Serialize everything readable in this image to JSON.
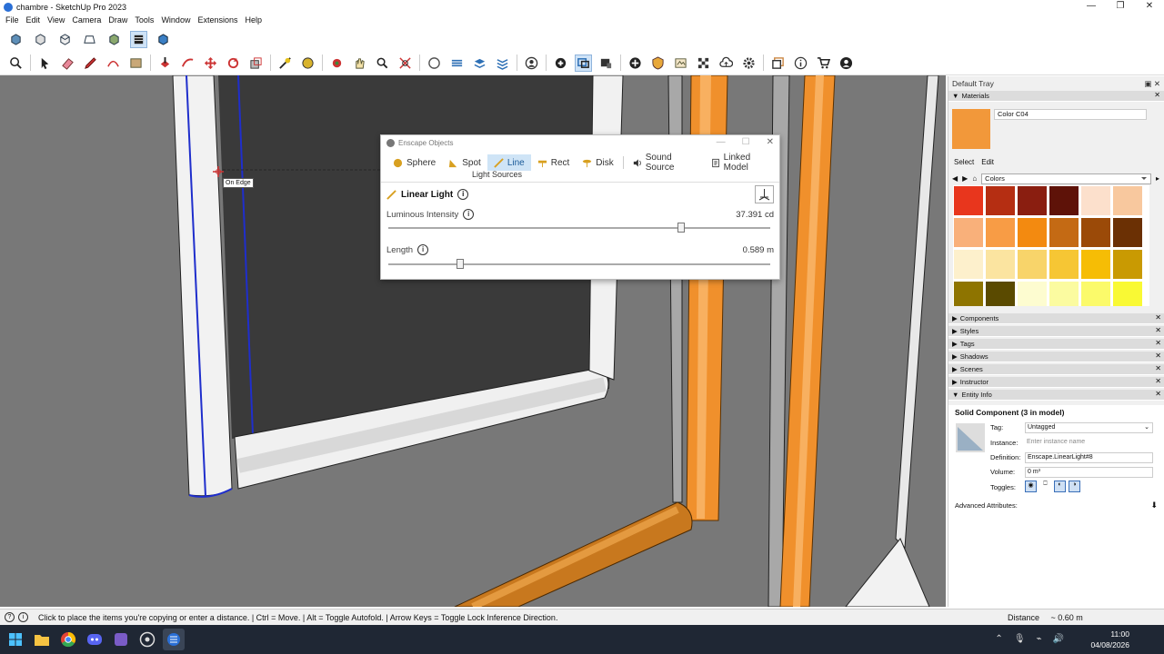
{
  "window": {
    "title": "chambre - SketchUp Pro 2023",
    "min": "—",
    "max": "❐",
    "close": "✕"
  },
  "menu": [
    "File",
    "Edit",
    "View",
    "Camera",
    "Draw",
    "Tools",
    "Window",
    "Extensions",
    "Help"
  ],
  "viewport": {
    "tooltip": "On Edge"
  },
  "enscape": {
    "title": "Enscape Objects",
    "tabs": [
      {
        "label": "Sphere",
        "icon": "sphere-light-icon"
      },
      {
        "label": "Spot",
        "icon": "spot-light-icon"
      },
      {
        "label": "Line",
        "icon": "line-light-icon",
        "active": true
      },
      {
        "label": "Rect",
        "icon": "rect-light-icon"
      },
      {
        "label": "Disk",
        "icon": "disk-light-icon"
      },
      {
        "label": "Sound Source",
        "icon": "speaker-icon"
      },
      {
        "label": "Linked Model",
        "icon": "linked-model-icon"
      }
    ],
    "group_label": "Light Sources",
    "object_title": "Linear Light",
    "luminous": {
      "label": "Luminous Intensity",
      "value": "37.391 cd",
      "fraction": 0.76
    },
    "length": {
      "label": "Length",
      "value": "0.589 m",
      "fraction": 0.19
    }
  },
  "tray": {
    "title": "Default Tray",
    "materials": {
      "header": "Materials",
      "name": "Color C04",
      "accent": "#f2983a",
      "tab_select": "Select",
      "tab_edit": "Edit",
      "library": "Colors",
      "swatches": [
        "#e8361d",
        "#b52e12",
        "#8a1e10",
        "#5e1208",
        "#fce0cc",
        "#f8c89e",
        "#f9b07a",
        "#f89c45",
        "#f38a10",
        "#c46a14",
        "#9b4a08",
        "#6b3004",
        "#fdf0cc",
        "#fbe4a0",
        "#f8d46a",
        "#f6c634",
        "#f6bd05",
        "#c99a02",
        "#8e7400",
        "#5a4a00",
        "#fdfcd0",
        "#fbfba0",
        "#fbfa6a",
        "#f9f934"
      ]
    },
    "collapsed": [
      "Components",
      "Styles",
      "Tags",
      "Shadows",
      "Scenes",
      "Instructor"
    ],
    "entity": {
      "header": "Entity Info",
      "title": "Solid Component (3 in model)",
      "tag_label": "Tag:",
      "tag_value": "Untagged",
      "instance_label": "Instance:",
      "instance_placeholder": "Enter instance name",
      "definition_label": "Definition:",
      "definition_value": "Enscape.LinearLight#8",
      "volume_label": "Volume:",
      "volume_value": "0 m³",
      "toggles_label": "Toggles:",
      "advanced_label": "Advanced Attributes:"
    }
  },
  "status": {
    "hint": "Click to place the items you're copying or enter a distance. | Ctrl = Move. | Alt = Toggle Autofold. | Arrow Keys = Toggle Lock Inference Direction.",
    "distance_label": "Distance",
    "distance_value": "~ 0.60 m"
  },
  "taskbar": {
    "time": "11:00",
    "date": "04/08/2026"
  }
}
